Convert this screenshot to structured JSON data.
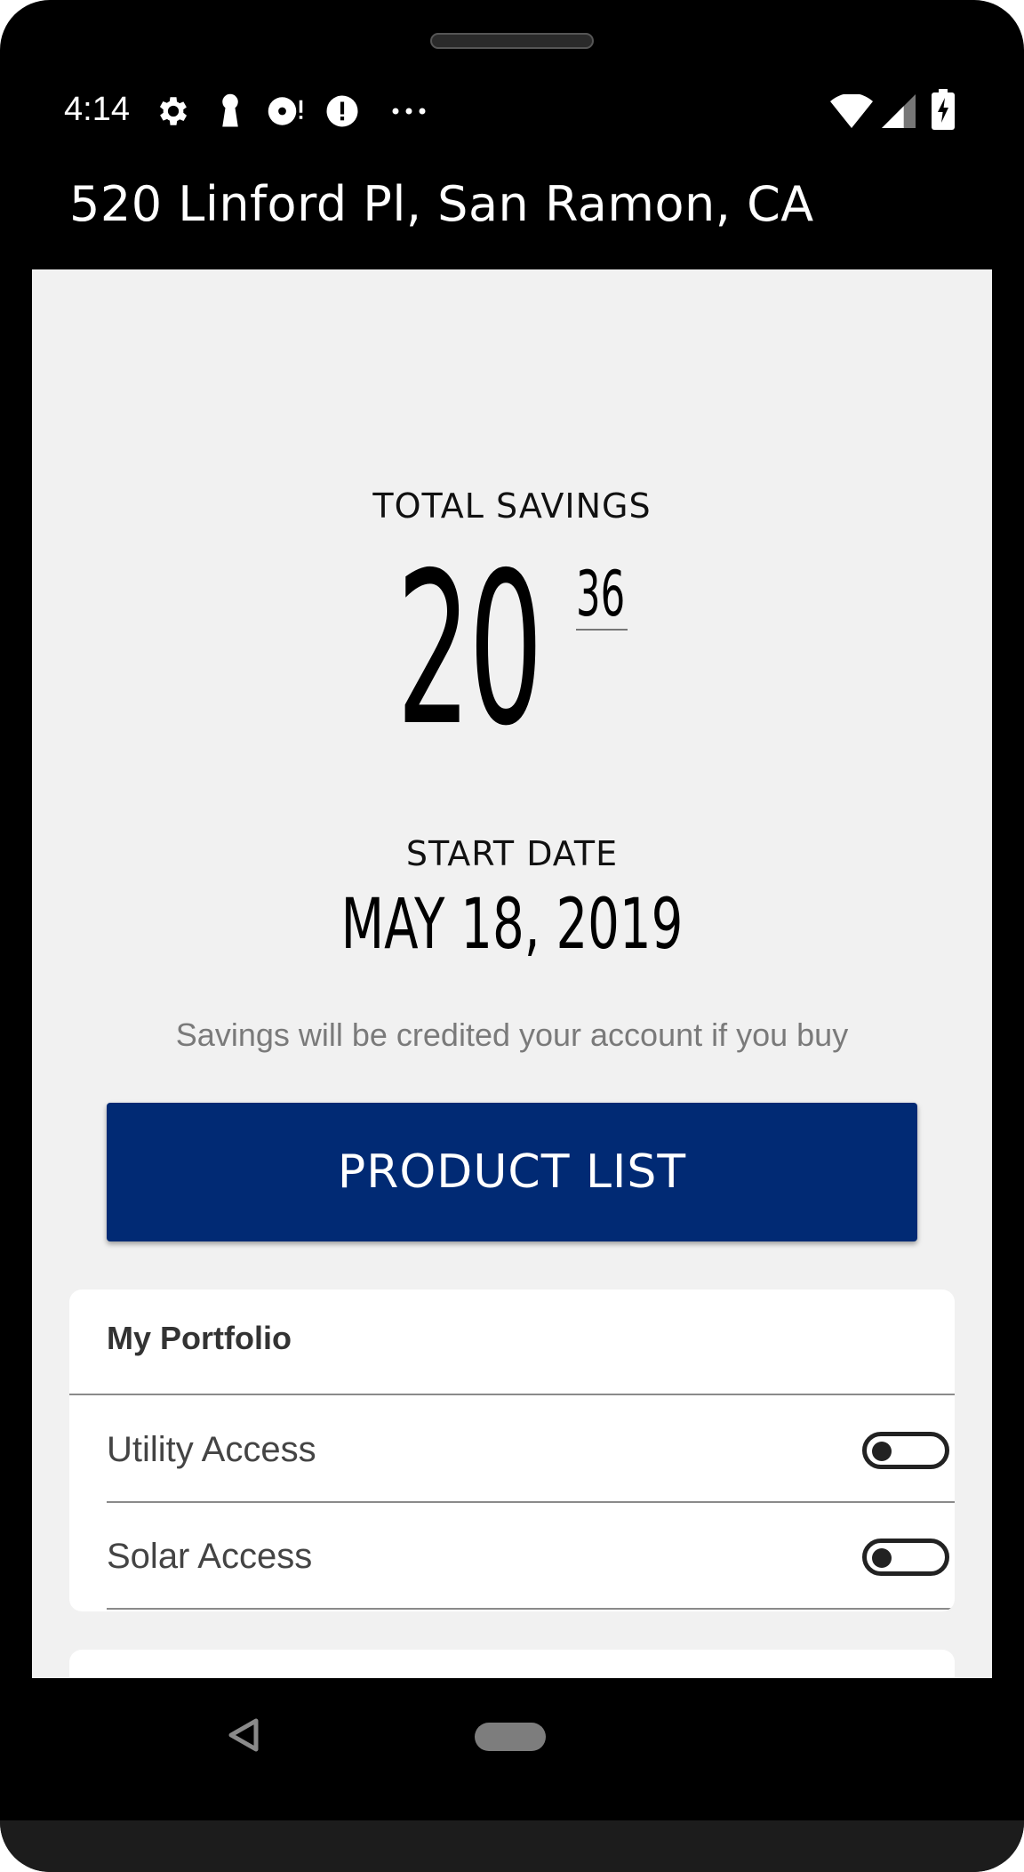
{
  "status_bar": {
    "time": "4:14",
    "icons": [
      "gear-icon",
      "keyhole-icon",
      "notification-disc-icon",
      "alert-icon",
      "more-dots-icon",
      "wifi-icon",
      "cell-signal-icon",
      "battery-charging-icon"
    ]
  },
  "header": {
    "title": "520 Linford Pl, San Ramon, CA"
  },
  "savings": {
    "label": "TOTAL SAVINGS",
    "whole": "20",
    "cents": "36"
  },
  "start": {
    "label": "START DATE",
    "date": "MAY 18, 2019"
  },
  "note": "Savings will be credited your account if you buy",
  "product_button": {
    "label": "PRODUCT LIST",
    "color": "#012a74"
  },
  "portfolio": {
    "title": "My Portfolio",
    "rows": [
      {
        "label": "Utility Access",
        "enabled": false
      },
      {
        "label": "Solar Access",
        "enabled": false
      }
    ]
  },
  "nav": {
    "icons": [
      "back-icon",
      "home-pill-icon"
    ]
  }
}
